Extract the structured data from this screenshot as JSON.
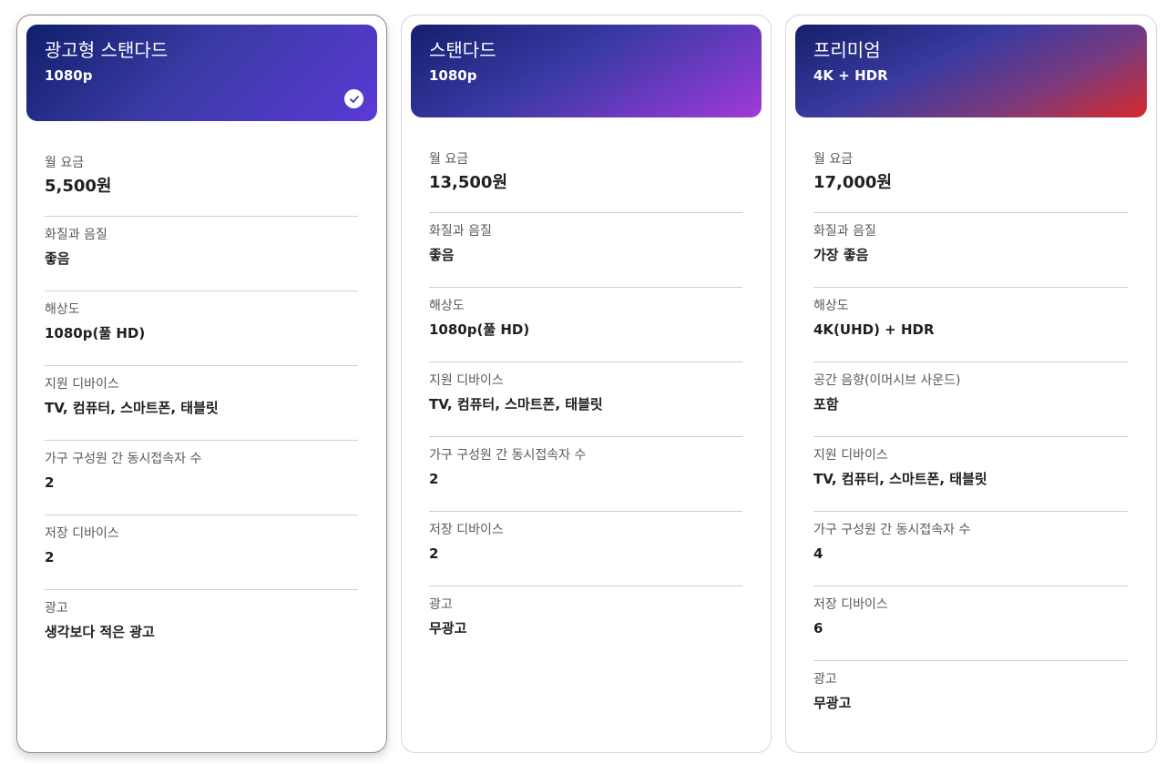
{
  "plans": [
    {
      "name": "광고형 스탠다드",
      "resolution": "1080p",
      "selected": true,
      "features": [
        {
          "label": "월 요금",
          "value": "5,500원"
        },
        {
          "label": "화질과 음질",
          "value": "좋음"
        },
        {
          "label": "해상도",
          "value": "1080p(풀 HD)"
        },
        {
          "label": "지원 디바이스",
          "value": "TV, 컴퓨터, 스마트폰, 태블릿"
        },
        {
          "label": "가구 구성원 간 동시접속자 수",
          "value": "2"
        },
        {
          "label": "저장 디바이스",
          "value": "2"
        },
        {
          "label": "광고",
          "value": "생각보다 적은 광고"
        }
      ]
    },
    {
      "name": "스탠다드",
      "resolution": "1080p",
      "selected": false,
      "features": [
        {
          "label": "월 요금",
          "value": "13,500원"
        },
        {
          "label": "화질과 음질",
          "value": "좋음"
        },
        {
          "label": "해상도",
          "value": "1080p(풀 HD)"
        },
        {
          "label": "지원 디바이스",
          "value": "TV, 컴퓨터, 스마트폰, 태블릿"
        },
        {
          "label": "가구 구성원 간 동시접속자 수",
          "value": "2"
        },
        {
          "label": "저장 디바이스",
          "value": "2"
        },
        {
          "label": "광고",
          "value": "무광고"
        }
      ]
    },
    {
      "name": "프리미엄",
      "resolution": "4K + HDR",
      "selected": false,
      "features": [
        {
          "label": "월 요금",
          "value": "17,000원"
        },
        {
          "label": "화질과 음질",
          "value": "가장 좋음"
        },
        {
          "label": "해상도",
          "value": "4K(UHD) + HDR"
        },
        {
          "label": "공간 음향(이머시브 사운드)",
          "value": "포함"
        },
        {
          "label": "지원 디바이스",
          "value": "TV, 컴퓨터, 스마트폰, 태블릿"
        },
        {
          "label": "가구 구성원 간 동시접속자 수",
          "value": "4"
        },
        {
          "label": "저장 디바이스",
          "value": "6"
        },
        {
          "label": "광고",
          "value": "무광고"
        }
      ]
    }
  ],
  "colors": {
    "selected_border": "#8c8c8c",
    "divider": "#cfcfcf",
    "label": "#595959",
    "value": "#202020"
  },
  "icons": {
    "selected": "check-circle-icon"
  }
}
